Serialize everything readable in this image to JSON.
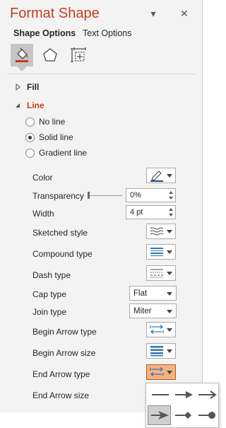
{
  "pane": {
    "title": "Format Shape",
    "close_glyph": "✕",
    "options_glyph": "▾",
    "tabs": [
      {
        "label": "Shape Options",
        "active": true
      },
      {
        "label": "Text Options",
        "active": false
      }
    ],
    "category_icons": [
      "fill-and-line-icon",
      "effects-icon",
      "size-properties-icon"
    ]
  },
  "sections": {
    "fill": {
      "label": "Fill",
      "expanded": false
    },
    "line": {
      "label": "Line",
      "expanded": true
    }
  },
  "line_type": {
    "options": [
      {
        "label": "No line",
        "checked": false
      },
      {
        "label": "Solid line",
        "checked": true
      },
      {
        "label": "Gradient line",
        "checked": false
      }
    ]
  },
  "properties": {
    "color": {
      "label": "Color"
    },
    "transparency": {
      "label": "Transparency",
      "value": "0%"
    },
    "width": {
      "label": "Width",
      "value": "4 pt"
    },
    "sketched_style": {
      "label": "Sketched style"
    },
    "compound_type": {
      "label": "Compound type"
    },
    "dash_type": {
      "label": "Dash type"
    },
    "cap_type": {
      "label": "Cap type",
      "value": "Flat"
    },
    "join_type": {
      "label": "Join type",
      "value": "Miter"
    },
    "begin_arrow_type": {
      "label": "Begin Arrow type"
    },
    "begin_arrow_size": {
      "label": "Begin Arrow size"
    },
    "end_arrow_type": {
      "label": "End Arrow type"
    },
    "end_arrow_size": {
      "label": "End Arrow size"
    }
  },
  "end_arrow_gallery": {
    "options": [
      "no-arrow",
      "arrow",
      "open-arrow",
      "stealth-arrow",
      "diamond-arrow",
      "oval-arrow"
    ],
    "selected": "stealth-arrow"
  },
  "colors": {
    "accent": "#c43e1c",
    "hover": "#f4b183",
    "pane_bg": "#f3f3f3"
  }
}
